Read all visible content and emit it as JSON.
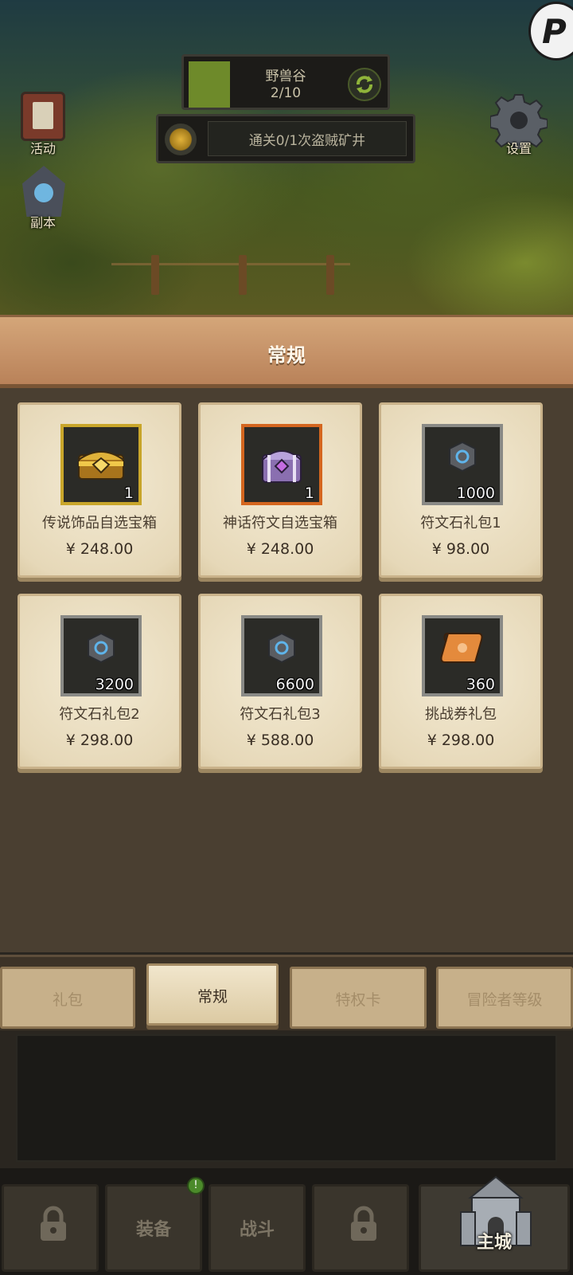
{
  "hud": {
    "stage_name": "野兽谷",
    "stage_progress": "2/10",
    "quest_text": "通关0/1次盗贼矿井",
    "activity_label": "活动",
    "dungeon_label": "副本",
    "settings_label": "设置"
  },
  "shop": {
    "title": "常规",
    "items": [
      {
        "name": "传说饰品自选宝箱",
        "price": "¥ 248.00",
        "qty": "1",
        "frame": "gold",
        "icon": "golden-chest-icon"
      },
      {
        "name": "神话符文自选宝箱",
        "price": "¥ 248.00",
        "qty": "1",
        "frame": "orange",
        "icon": "purple-chest-icon"
      },
      {
        "name": "符文石礼包1",
        "price": "¥ 98.00",
        "qty": "1000",
        "frame": "gray",
        "icon": "rune-stone-icon"
      },
      {
        "name": "符文石礼包2",
        "price": "¥ 298.00",
        "qty": "3200",
        "frame": "gray",
        "icon": "rune-stone-icon"
      },
      {
        "name": "符文石礼包3",
        "price": "¥ 588.00",
        "qty": "6600",
        "frame": "gray",
        "icon": "rune-stone-icon"
      },
      {
        "name": "挑战券礼包",
        "price": "¥ 298.00",
        "qty": "360",
        "frame": "gray",
        "icon": "scroll-ticket-icon"
      }
    ]
  },
  "tabs": [
    {
      "label": "礼包",
      "active": false
    },
    {
      "label": "常规",
      "active": true
    },
    {
      "label": "特权卡",
      "active": false
    },
    {
      "label": "冒险者等级",
      "active": false
    }
  ],
  "nav": {
    "equipment_label": "装备",
    "equipment_badge": "!",
    "battle_label": "战斗",
    "home_label": "主城"
  },
  "colors": {
    "panel_bg": "#4a3f31",
    "header_wood": "#c7946a",
    "card_bg": "#f3ead3",
    "gold_frame": "#c9a62a",
    "orange_frame": "#d4661f"
  }
}
